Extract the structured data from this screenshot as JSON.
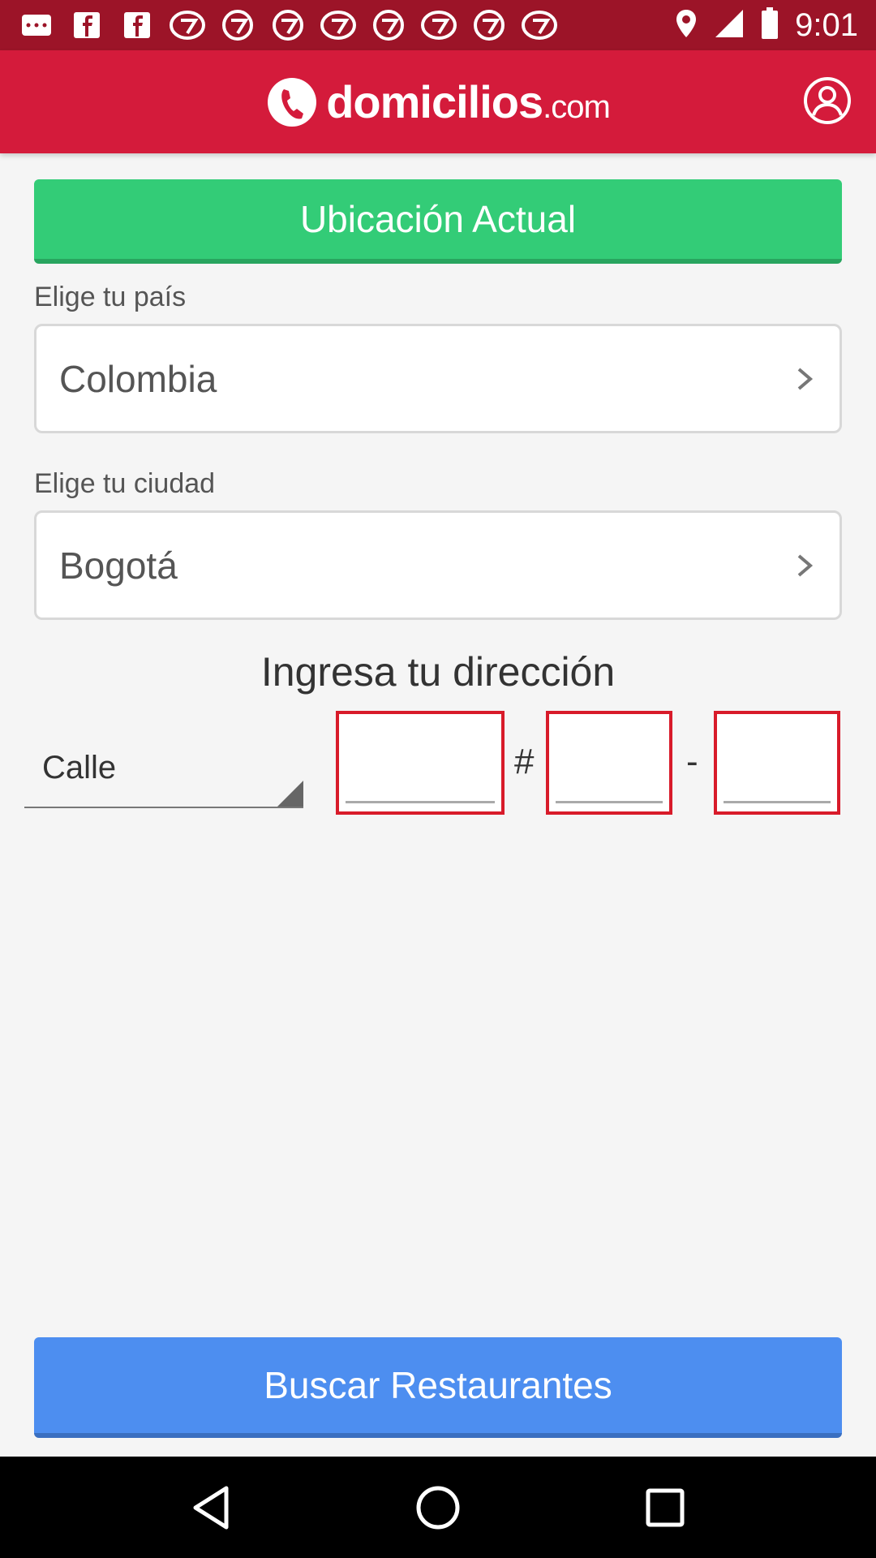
{
  "status_bar": {
    "time": "9:01",
    "notification_icons": [
      "message-icon",
      "facebook-icon",
      "facebook-icon",
      "abc7-icon",
      "abc7-icon",
      "abc7-icon",
      "abc7-icon",
      "abc7-icon",
      "abc7-icon",
      "abc7-icon",
      "abc7-icon",
      "abc7-icon"
    ],
    "system_icons": [
      "location-icon",
      "signal-icon",
      "battery-icon"
    ]
  },
  "app_bar": {
    "brand": "domicilios",
    "brand_suffix": ".com",
    "profile_icon": "user-icon"
  },
  "current_location_button": "Ubicación Actual",
  "country": {
    "label": "Elige tu país",
    "value": "Colombia"
  },
  "city": {
    "label": "Elige tu ciudad",
    "value": "Bogotá"
  },
  "address": {
    "title": "Ingresa tu dirección",
    "street_type": "Calle",
    "hash_separator": "#",
    "dash_separator": "-",
    "field_1": "",
    "field_2": "",
    "field_3": ""
  },
  "search_button": "Buscar Restaurantes",
  "nav": {
    "back": "back-icon",
    "home": "home-icon",
    "recents": "recents-icon"
  },
  "colors": {
    "status_bar": "#9c1428",
    "app_bar": "#d41b3b",
    "current_location": "#33cc77",
    "search": "#4d8ef0",
    "input_border": "#d81b2a"
  }
}
